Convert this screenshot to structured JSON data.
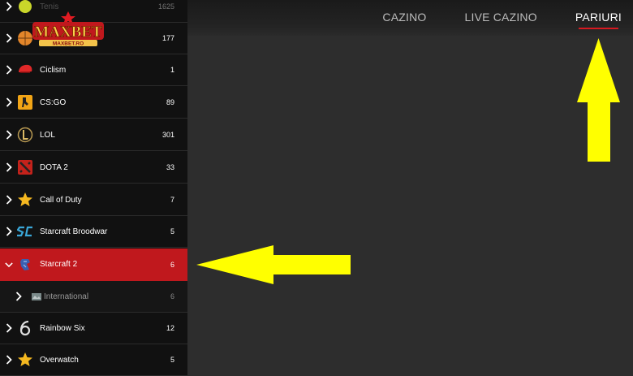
{
  "topnav": {
    "items": [
      {
        "label": "CAZINO"
      },
      {
        "label": "LIVE CAZINO"
      },
      {
        "label": "PARIURI"
      }
    ],
    "active": "PARIURI"
  },
  "logo": {
    "text": "MAXBET",
    "subtext": "MAXBET.RO"
  },
  "sidebar": {
    "rows": [
      {
        "label": "Tenis",
        "count": "1625"
      },
      {
        "label": "",
        "count": "177"
      },
      {
        "label": "Ciclism",
        "count": "1"
      },
      {
        "label": "CS:GO",
        "count": "89"
      },
      {
        "label": "LOL",
        "count": "301"
      },
      {
        "label": "DOTA 2",
        "count": "33"
      },
      {
        "label": "Call of Duty",
        "count": "7"
      },
      {
        "label": "Starcraft Broodwar",
        "count": "5"
      },
      {
        "label": "Starcraft 2",
        "count": "6"
      },
      {
        "label": "International",
        "count": "6"
      },
      {
        "label": "Rainbow Six",
        "count": "12"
      },
      {
        "label": "Overwatch",
        "count": "5"
      }
    ]
  },
  "colors": {
    "accent": "#c0181d",
    "arrow": "#ffff00",
    "sidebar_bg": "#111111",
    "content_bg": "#2d2d2d"
  }
}
